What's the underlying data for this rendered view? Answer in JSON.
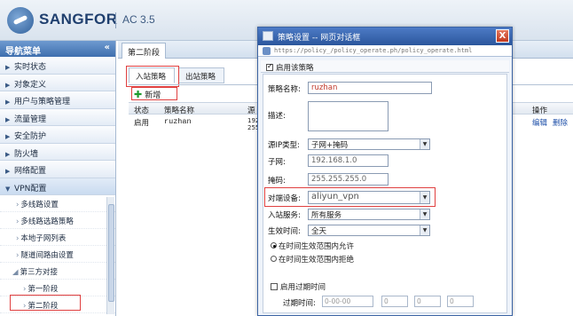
{
  "header": {
    "brand": "SANGFOR",
    "version": "AC 3.5"
  },
  "sidebar": {
    "title": "导航菜单",
    "collapse_label": "«",
    "items": [
      {
        "label": "实时状态"
      },
      {
        "label": "对象定义"
      },
      {
        "label": "用户与策略管理"
      },
      {
        "label": "流量管理"
      },
      {
        "label": "安全防护"
      },
      {
        "label": "防火墙"
      },
      {
        "label": "网络配置"
      },
      {
        "label": "VPN配置"
      }
    ],
    "vpn_sub": [
      {
        "label": "多线路设置"
      },
      {
        "label": "多线路选路策略"
      },
      {
        "label": "本地子网列表"
      },
      {
        "label": "隧道间路由设置"
      },
      {
        "label": "第三方对接"
      },
      {
        "label": "第一阶段"
      },
      {
        "label": "第二阶段"
      }
    ]
  },
  "main": {
    "tab": "第二阶段",
    "sub_tabs": [
      "入站策略",
      "出站策略"
    ],
    "add_label": "新增",
    "columns": [
      "状态",
      "策略名称",
      "源",
      "操作"
    ],
    "rows": [
      {
        "status": "启用",
        "name": "ruzhan",
        "src": "192 255",
        "edit": "编辑",
        "delete": "删除"
      }
    ]
  },
  "dialog": {
    "title": "策略设置 -- 网页对话框",
    "url": "https://policy_/policy_operate.ph/policy_operate.html",
    "close_label": "X",
    "enable_label": "启用该策略",
    "fields": {
      "name_label": "策略名称:",
      "name_value": "ruzhan",
      "desc_label": "描述:",
      "src_type_label": "源IP类型:",
      "src_type_value": "子网+掩码",
      "subnet_label": "子网:",
      "subnet_value": "192.168.1.0",
      "mask_label": "掩码:",
      "mask_value": "255.255.255.0",
      "peer_label": "对端设备:",
      "peer_value": "aliyun_vpn",
      "service_label": "入站服务:",
      "service_value": "所有服务",
      "time_label": "生效时间:",
      "time_value": "全天",
      "radio_allow": "在时间生效范围内允许",
      "radio_deny": "在时间生效范围内拒绝",
      "expire_label": "启用过期时间",
      "expire_time_label": "过期时间:",
      "expire_date_placeholder": "0-00-00",
      "expire_h": "0",
      "expire_m": "0",
      "expire_s": "0"
    }
  },
  "colors": {
    "accent": "#2b569c",
    "highlight": "#e04040"
  }
}
